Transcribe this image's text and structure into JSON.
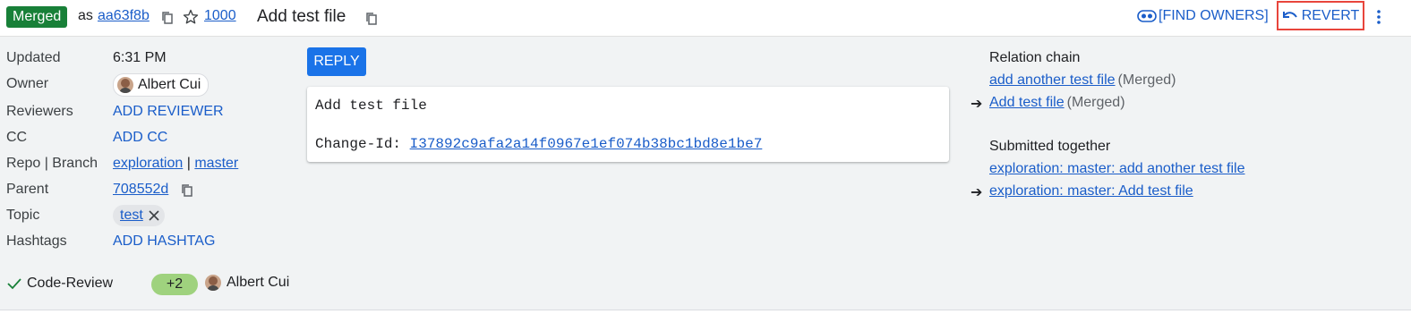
{
  "header": {
    "status_badge": "Merged",
    "as_text": "as",
    "commit_hash": "aa63f8b",
    "star_count": "1000",
    "change_title": "Add test file",
    "find_owners_label": "[FIND OWNERS]",
    "revert_label": "REVERT"
  },
  "metadata": {
    "updated": {
      "label": "Updated",
      "value": "6:31 PM"
    },
    "owner": {
      "label": "Owner",
      "value": "Albert Cui"
    },
    "reviewers": {
      "label": "Reviewers",
      "value": "ADD REVIEWER"
    },
    "cc": {
      "label": "CC",
      "value": "ADD CC"
    },
    "repo_branch": {
      "label": "Repo | Branch",
      "repo": "exploration",
      "separator": "|",
      "branch": "master"
    },
    "parent": {
      "label": "Parent",
      "value": "708552d"
    },
    "topic": {
      "label": "Topic",
      "value": "test"
    },
    "hashtags": {
      "label": "Hashtags",
      "value": "ADD HASHTAG"
    }
  },
  "reply_label": "REPLY",
  "commit_message": {
    "subject": "Add test file",
    "change_id_label": "Change-Id: ",
    "change_id": "I37892c9afa2a14f0967e1ef074b38bc1bd8e1be7"
  },
  "relation_chain": {
    "title": "Relation chain",
    "items": [
      {
        "text": "add another test file",
        "status": "(Merged)"
      },
      {
        "text": "Add test file",
        "status": "(Merged)"
      }
    ]
  },
  "submitted_together": {
    "title": "Submitted together",
    "items": [
      {
        "text": "exploration: master: add another test file"
      },
      {
        "text": "exploration: master: Add test file"
      }
    ]
  },
  "labels": {
    "code_review": {
      "label": "Code-Review",
      "vote": "+2",
      "voter": "Albert Cui"
    }
  },
  "colors": {
    "merged_green": "#188038",
    "link_blue": "#1a5dc9",
    "reply_blue": "#1a73e8",
    "vote_green": "#9fd27e",
    "highlight_red": "#e8453c"
  }
}
